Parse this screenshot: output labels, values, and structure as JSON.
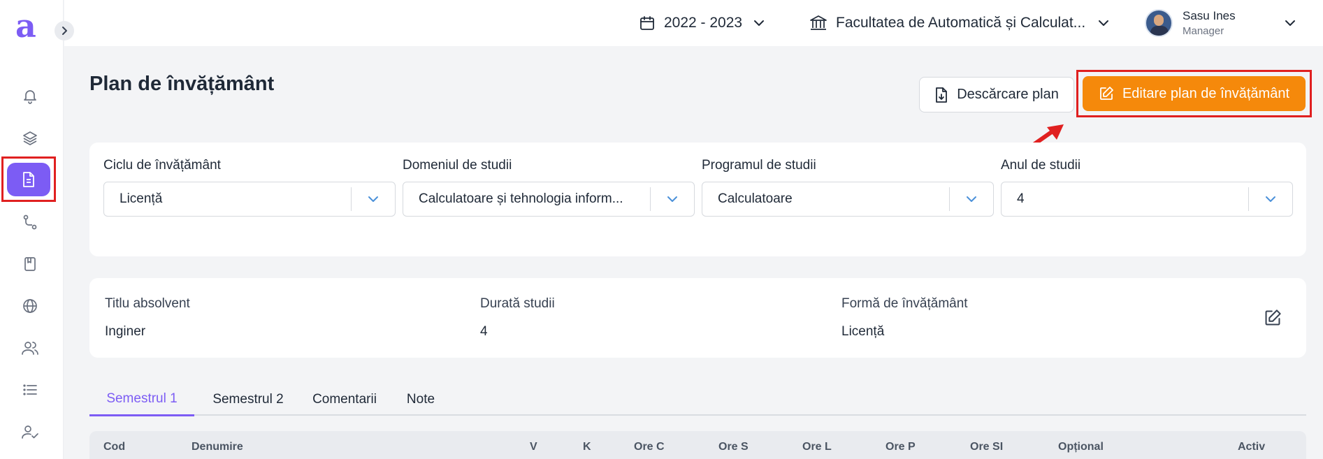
{
  "app": {
    "logo_letter": "a"
  },
  "topbar": {
    "year": "2022 - 2023",
    "faculty": "Facultatea de Automatică și Calculat...",
    "user_name": "Sasu Ines",
    "user_role": "Manager"
  },
  "sidebar": {
    "items": [
      {
        "name": "bell-icon"
      },
      {
        "name": "layers-icon"
      },
      {
        "name": "document-icon",
        "active": true
      },
      {
        "name": "route-icon"
      },
      {
        "name": "book-icon"
      },
      {
        "name": "globe-icon"
      },
      {
        "name": "users-icon"
      },
      {
        "name": "list-icon"
      },
      {
        "name": "user-check-icon"
      }
    ]
  },
  "page": {
    "title": "Plan de învățământ",
    "download_label": "Descărcare plan",
    "edit_label": "Editare plan de învățământ"
  },
  "filters": [
    {
      "label": "Ciclu de învățământ",
      "value": "Licență"
    },
    {
      "label": "Domeniul de studii",
      "value": "Calculatoare și tehnologia inform..."
    },
    {
      "label": "Programul de studii",
      "value": "Calculatoare"
    },
    {
      "label": "Anul de studii",
      "value": "4"
    }
  ],
  "info": {
    "title_label": "Titlu absolvent",
    "title_value": "Inginer",
    "duration_label": "Durată studii",
    "duration_value": "4",
    "form_label": "Formă de învățământ",
    "form_value": "Licență"
  },
  "tabs": [
    "Semestrul 1",
    "Semestrul 2",
    "Comentarii",
    "Note"
  ],
  "table": {
    "columns": [
      "Cod",
      "Denumire",
      "V",
      "K",
      "Ore C",
      "Ore S",
      "Ore L",
      "Ore P",
      "Ore SI",
      "Opțional",
      "Activ"
    ]
  },
  "colors": {
    "accent": "#7c5cf4",
    "edit_button": "#f5890b",
    "highlight": "#e02020"
  }
}
